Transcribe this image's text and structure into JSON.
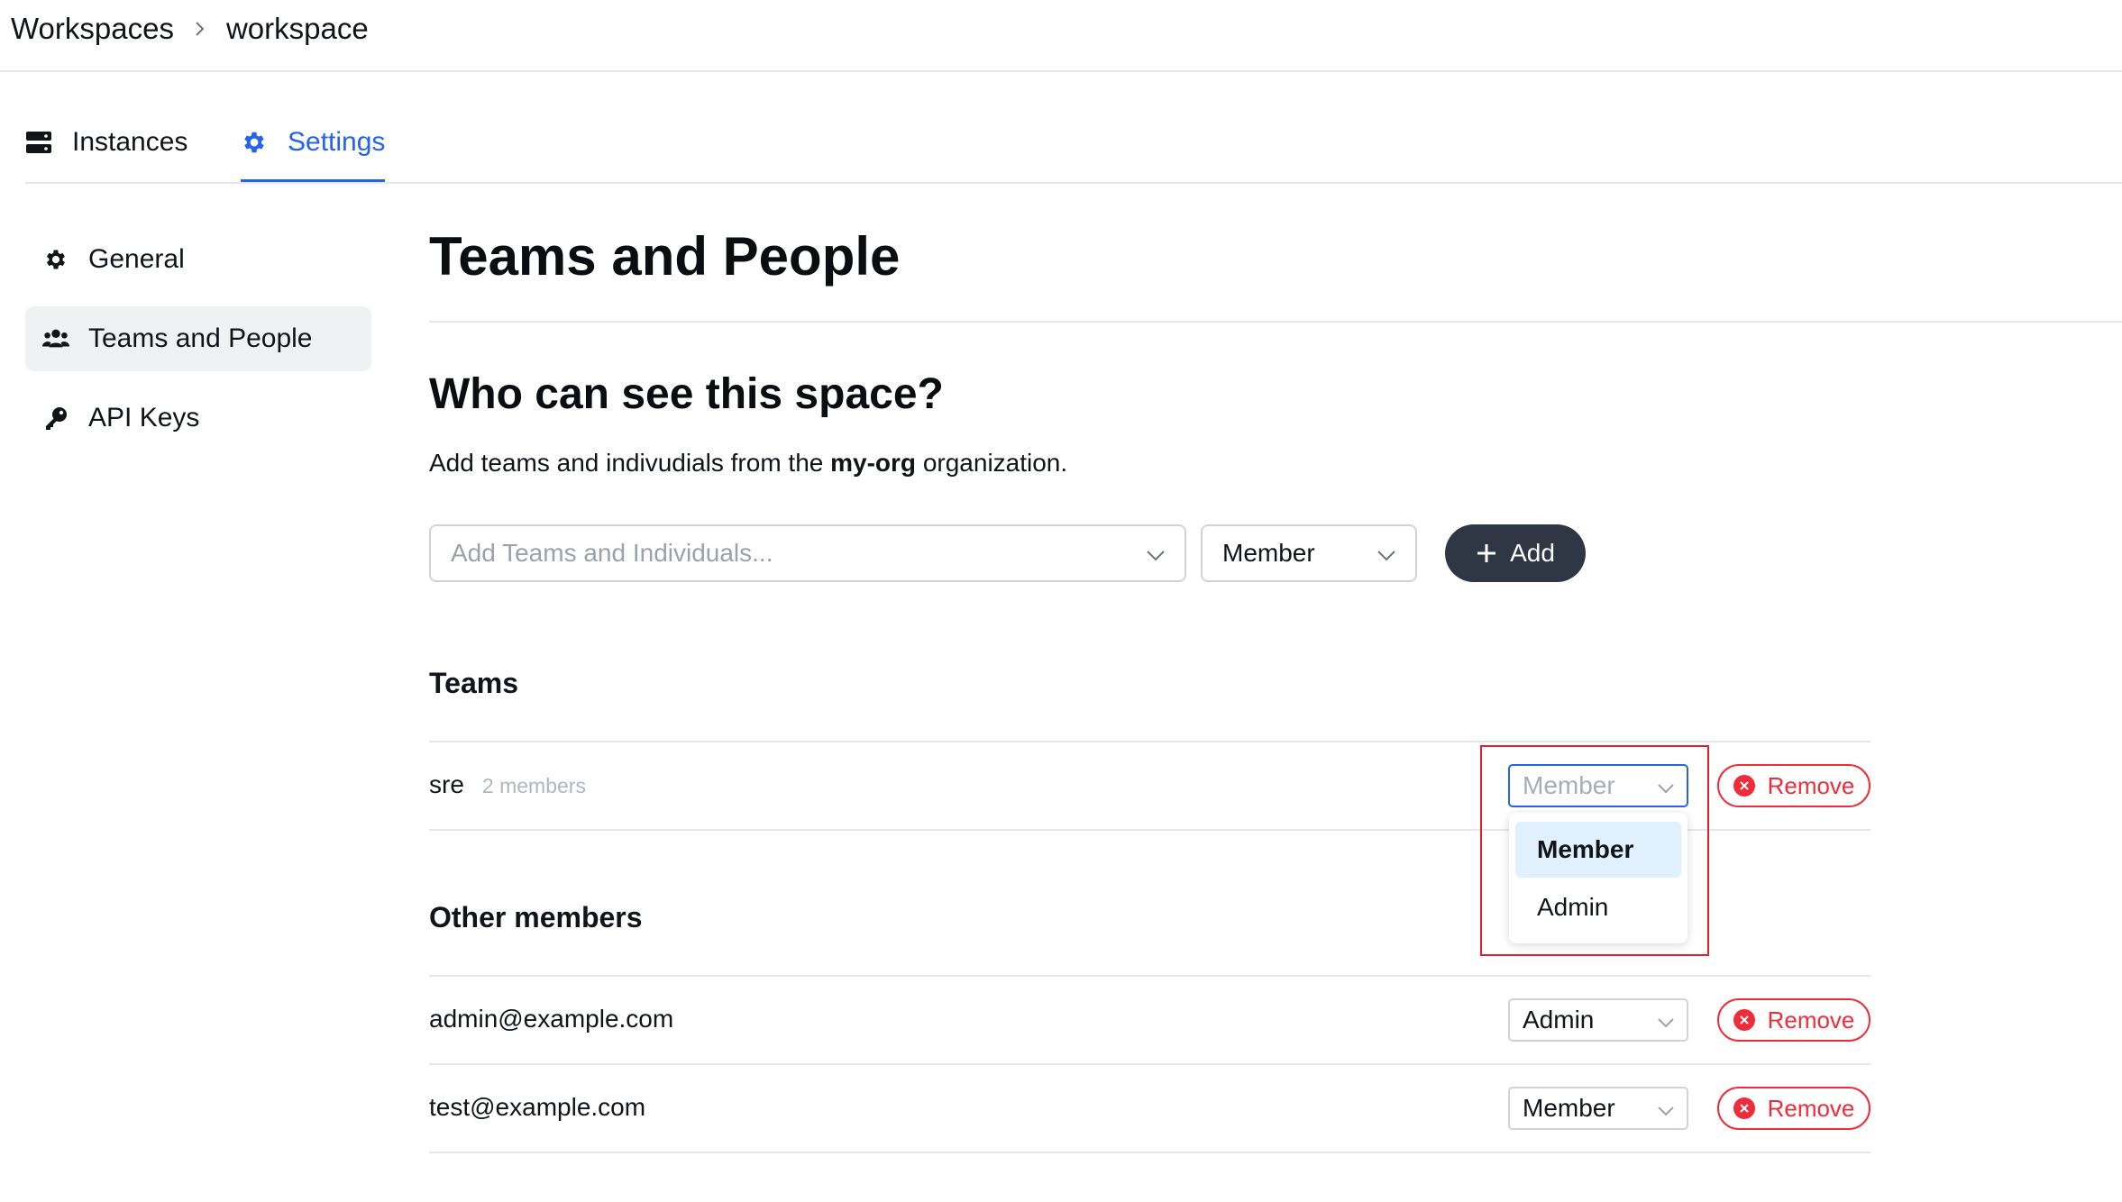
{
  "breadcrumb": {
    "root": "Workspaces",
    "current": "workspace"
  },
  "tabs": [
    {
      "label": "Instances",
      "icon": "server-icon",
      "active": false
    },
    {
      "label": "Settings",
      "icon": "gear-icon",
      "active": true
    }
  ],
  "sidebar": {
    "items": [
      {
        "label": "General",
        "icon": "gear-icon"
      },
      {
        "label": "Teams and People",
        "icon": "users-icon",
        "active": true
      },
      {
        "label": "API Keys",
        "icon": "key-icon"
      }
    ]
  },
  "main": {
    "title": "Teams and People",
    "subtitle": "Who can see this space?",
    "description": {
      "before": "Add teams and indivudials from the ",
      "org": "my-org",
      "after": " organization."
    },
    "add_form": {
      "search_placeholder": "Add Teams and Individuals...",
      "role_value": "Member",
      "add_label": "Add"
    },
    "teams_heading": "Teams",
    "teams": [
      {
        "name": "sre",
        "meta": "2 members",
        "role": "Member",
        "remove_label": "Remove"
      }
    ],
    "other_heading": "Other members",
    "members": [
      {
        "email": "admin@example.com",
        "role": "Admin",
        "remove_label": "Remove"
      },
      {
        "email": "test@example.com",
        "role": "Member",
        "remove_label": "Remove"
      }
    ]
  },
  "role_dropdown": {
    "options": [
      "Member",
      "Admin"
    ],
    "selected": "Member"
  },
  "colors": {
    "accent": "#2563eb",
    "danger": "#ef2d3a",
    "dark_button": "#2f3744"
  }
}
